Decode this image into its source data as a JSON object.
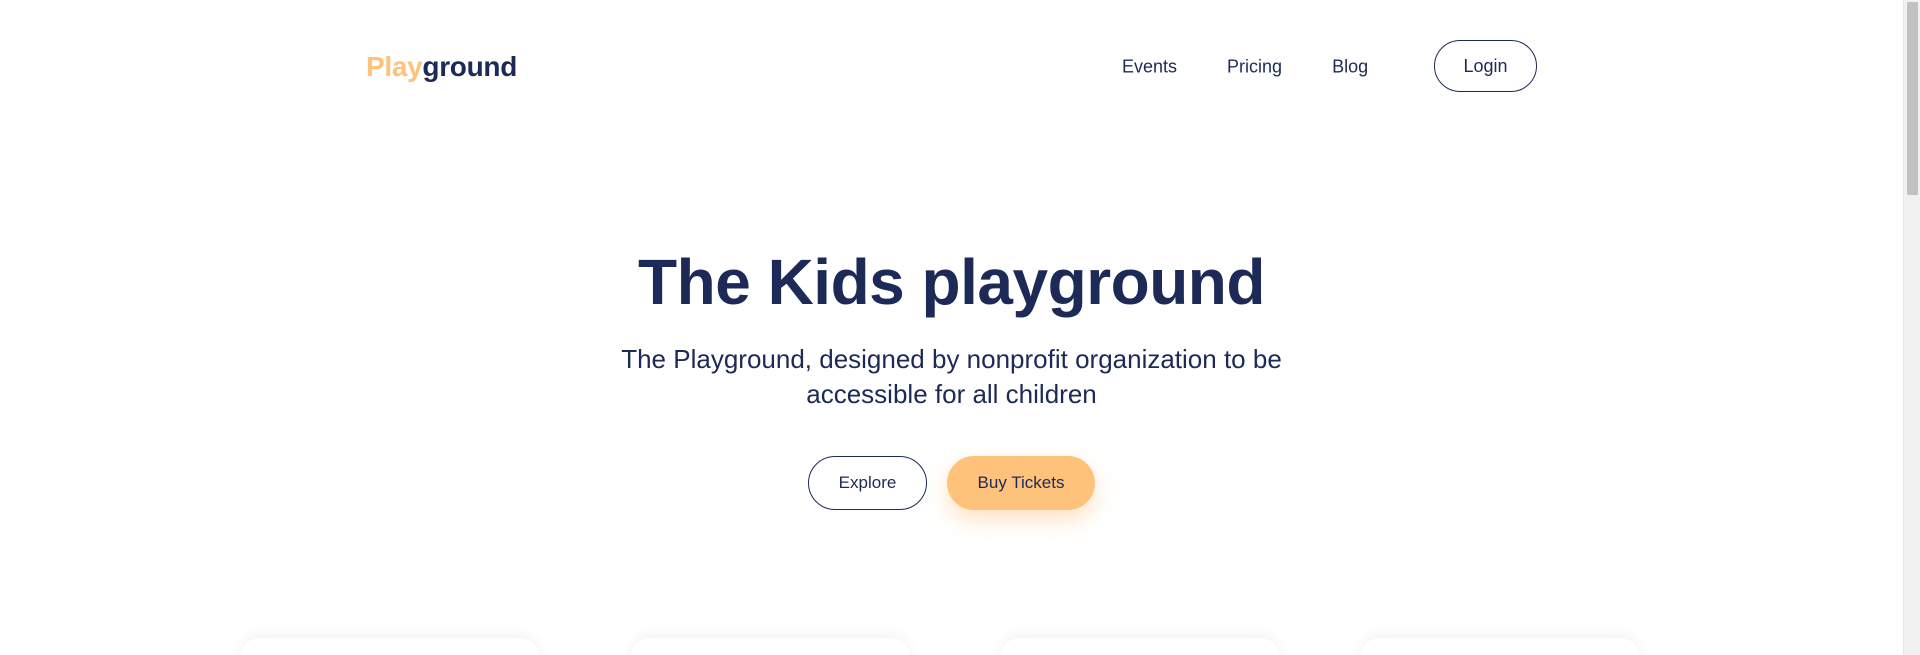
{
  "brand": {
    "logo_part1": "Play",
    "logo_part2": "ground",
    "accent_color": "#ffc27a",
    "primary_color": "#1d2957"
  },
  "nav": {
    "items": [
      {
        "label": "Events"
      },
      {
        "label": "Pricing"
      },
      {
        "label": "Blog"
      }
    ],
    "login_label": "Login"
  },
  "hero": {
    "title": "The Kids playground",
    "subtitle": "The Playground, designed by nonprofit organization to be accessible for all children",
    "explore_label": "Explore",
    "buy_label": "Buy Tickets"
  }
}
